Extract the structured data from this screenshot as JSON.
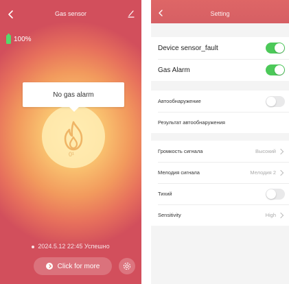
{
  "left": {
    "title": "Gas sensor",
    "battery": "100%",
    "alarm_text": "No gas alarm",
    "sensor_mark": "0¹",
    "status_line": "2024.5.12 22:45 Успешно",
    "more_button": "Click for more"
  },
  "right": {
    "title": "Setting",
    "group1": [
      {
        "label": "Device sensor_fault",
        "toggle": true
      },
      {
        "label": "Gas Alarm",
        "toggle": true
      }
    ],
    "group2": [
      {
        "label": "Автообнаружение",
        "toggle": false
      },
      {
        "label": "Результат автообнаружения"
      }
    ],
    "group3": [
      {
        "label": "Громкость сигнала",
        "value": "Высокий"
      },
      {
        "label": "Мелодия сигнала",
        "value": "Мелодия 2"
      },
      {
        "label": "Тихий",
        "toggle": false
      },
      {
        "label": "Sensitivity",
        "value": "High"
      }
    ]
  },
  "colors": {
    "accent_green": "#4cc959",
    "header_red": "#d65f64",
    "battery_green": "#56d86c"
  },
  "icons": [
    "back-icon",
    "edit-icon",
    "flame-icon",
    "battery-icon",
    "arrow-right-icon",
    "gear-icon",
    "chevron-right-icon"
  ]
}
